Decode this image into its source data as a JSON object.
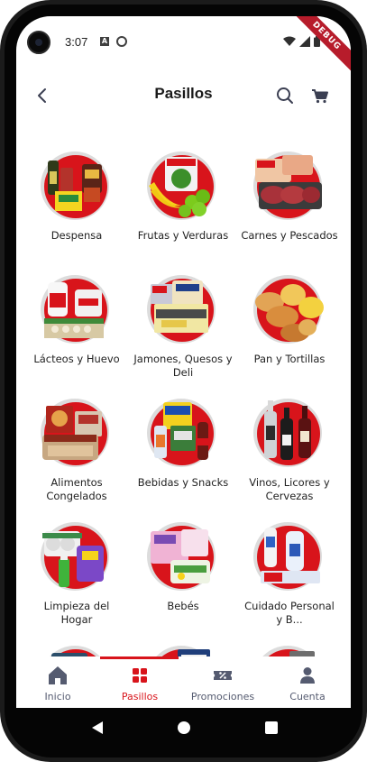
{
  "status_bar": {
    "time": "3:07",
    "icon_a": "A",
    "debug_label": "DEBUG",
    "icons": [
      "wifi-icon",
      "signal-icon",
      "battery-icon"
    ]
  },
  "app_bar": {
    "title": "Pasillos",
    "icons": [
      "back-arrow-icon",
      "search-icon",
      "cart-icon"
    ]
  },
  "categories": [
    {
      "label": "Despensa"
    },
    {
      "label": "Frutas y Verduras"
    },
    {
      "label": "Carnes y Pescados"
    },
    {
      "label": "Lácteos y Huevo"
    },
    {
      "label": "Jamones, Quesos y Deli"
    },
    {
      "label": "Pan y Tortillas"
    },
    {
      "label": "Alimentos Congelados"
    },
    {
      "label": "Bebidas y Snacks"
    },
    {
      "label": "Vinos, Licores y Cervezas"
    },
    {
      "label": "Limpieza del Hogar"
    },
    {
      "label": "Bebés"
    },
    {
      "label": "Cuidado Personal y B..."
    },
    {
      "label": ""
    },
    {
      "label": ""
    },
    {
      "label": ""
    }
  ],
  "bottom_nav": {
    "active": "Pasillos",
    "items": [
      {
        "label": "Inicio",
        "icon": "home-icon"
      },
      {
        "label": "Pasillos",
        "icon": "grid-icon"
      },
      {
        "label": "Promociones",
        "icon": "ticket-icon"
      },
      {
        "label": "Cuenta",
        "icon": "user-icon"
      }
    ]
  },
  "colors": {
    "accent": "#d8141b",
    "nav_inactive": "#555b70",
    "title": "#1a1a1a",
    "debug_banner": "#b71c2b"
  }
}
